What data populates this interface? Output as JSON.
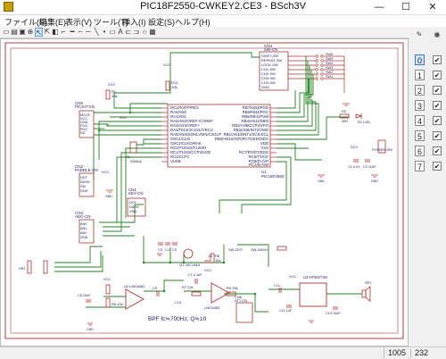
{
  "window": {
    "title": "PIC18F2550-CWKEY2.CE3 - BSch3V",
    "minimize": "—",
    "maximize": "☐",
    "close": "✕"
  },
  "menu": [
    "ファイル(F)",
    "編集(E)",
    "表示(V)",
    "ツール(T)",
    "挿入(I)",
    "設定(S)",
    "ヘルプ(H)"
  ],
  "layers": {
    "items": [
      {
        "num": "0",
        "selected": true,
        "checked": true
      },
      {
        "num": "1",
        "selected": false,
        "checked": true
      },
      {
        "num": "2",
        "selected": false,
        "checked": true
      },
      {
        "num": "3",
        "selected": false,
        "checked": true
      },
      {
        "num": "4",
        "selected": false,
        "checked": true
      },
      {
        "num": "5",
        "selected": false,
        "checked": true
      },
      {
        "num": "6",
        "selected": false,
        "checked": true
      },
      {
        "num": "7",
        "selected": false,
        "checked": true
      }
    ],
    "check": "✔"
  },
  "status": {
    "x": "1005",
    "y": "232"
  },
  "schematic": {
    "u1": {
      "ref": "U1",
      "part": "PIC18F2550",
      "left_pins": [
        "MCLR/VPP/RE3",
        "RA0/AN0",
        "RA1/AN1",
        "RA2/AN2/VREF-/CVREF",
        "RA3/AN3/VREF+",
        "RA4/T0CKI/C1OUT/RCV",
        "RA5/AN4/SS/HLVDIN/C2OUT",
        "OSC1/CLKI",
        "OSC2/CLKO/RA6",
        "RC0/T1OSO/T13CKI",
        "RC1/T1OSI/CCP2/UOE",
        "RC2/CCP1",
        "VUSB"
      ],
      "right_pins": [
        "RB7/KBI3/PGD",
        "RB6/KBI2/PGC",
        "RB5/KBI1/PGM",
        "RB4/AN11/KBI0",
        "RB3/AN9/CCP2/VPO",
        "RB2/AN8/INT2/VMO",
        "RB1/AN10/INT1/SCK/SCL",
        "RB0/AN12/INT0/FLT0/SDI/SDA",
        "VDD",
        "VSS",
        "RC7/RX/DT/SDO",
        "RC6/TX/CK",
        "RC5/D+/VP",
        "RC4/D-/VM"
      ]
    },
    "cn4": {
      "ref": "CN4",
      "part": "SW-CN",
      "pins": [
        "SHIFT-SW",
        "REPEAT-SW",
        "LOCK-SW",
        "CH1-SW",
        "CH2-SW",
        "CH3-SW",
        "CH4-SW",
        "GND"
      ]
    },
    "sw": [
      "SW6",
      "SW5",
      "SW4",
      "SW3",
      "SW2",
      "SW1"
    ],
    "cn5": {
      "ref": "CN5",
      "part": "PICKIT-CN",
      "pins": [
        "MCLR",
        "VCC",
        "GND",
        "PGD",
        "PGC",
        "NC"
      ]
    },
    "cn2": {
      "ref": "CN2",
      "part": "PADDLE-CN",
      "pins": [
        "DOT",
        "DASH",
        "SW",
        "GND"
      ]
    },
    "cn3": {
      "ref": "CN3",
      "part": "ADC-CN",
      "pins": [
        "AN0",
        "AN1",
        "AN2",
        "GND"
      ]
    },
    "cn1": {
      "ref": "CN1",
      "part": "KEY-CN",
      "pins": [
        "DOT",
        "DASH",
        "GND"
      ]
    },
    "cn6": {
      "ref": "CN6",
      "part": "ATT-CN"
    },
    "x1": {
      "ref": "X1",
      "value": "20MHz"
    },
    "r_labels": [
      "R1",
      "10k",
      "R13",
      "10k",
      "R2",
      "390",
      "R6",
      "10k",
      "R7 22k",
      "R9 33k",
      "R8 10k"
    ],
    "c_labels": [
      "C3",
      "C4",
      "C5",
      "C6",
      "C7 0.1uF",
      "C8 10uF",
      "C9",
      "C10",
      "C12",
      "C11 1uF",
      "C13 10uF",
      "C1 0.01",
      "C2 10uF"
    ],
    "ics": {
      "u2": "U2 LMC6482",
      "u3": "U3 HT82V739",
      "lmc": "LMC6482"
    },
    "misc": {
      "vcc": "VCC",
      "gnd": "GND",
      "power_sw": "POWER-SW",
      "vr": "VR1",
      "led": "D1 LED",
      "sp": "SP1",
      "bpf_note": "BPF fc≒700Hz, Q≒10",
      "sw_dot": "SW-DOT",
      "sw_dash": "SW-DASH",
      "q1": "Q1 2SC1815"
    }
  }
}
